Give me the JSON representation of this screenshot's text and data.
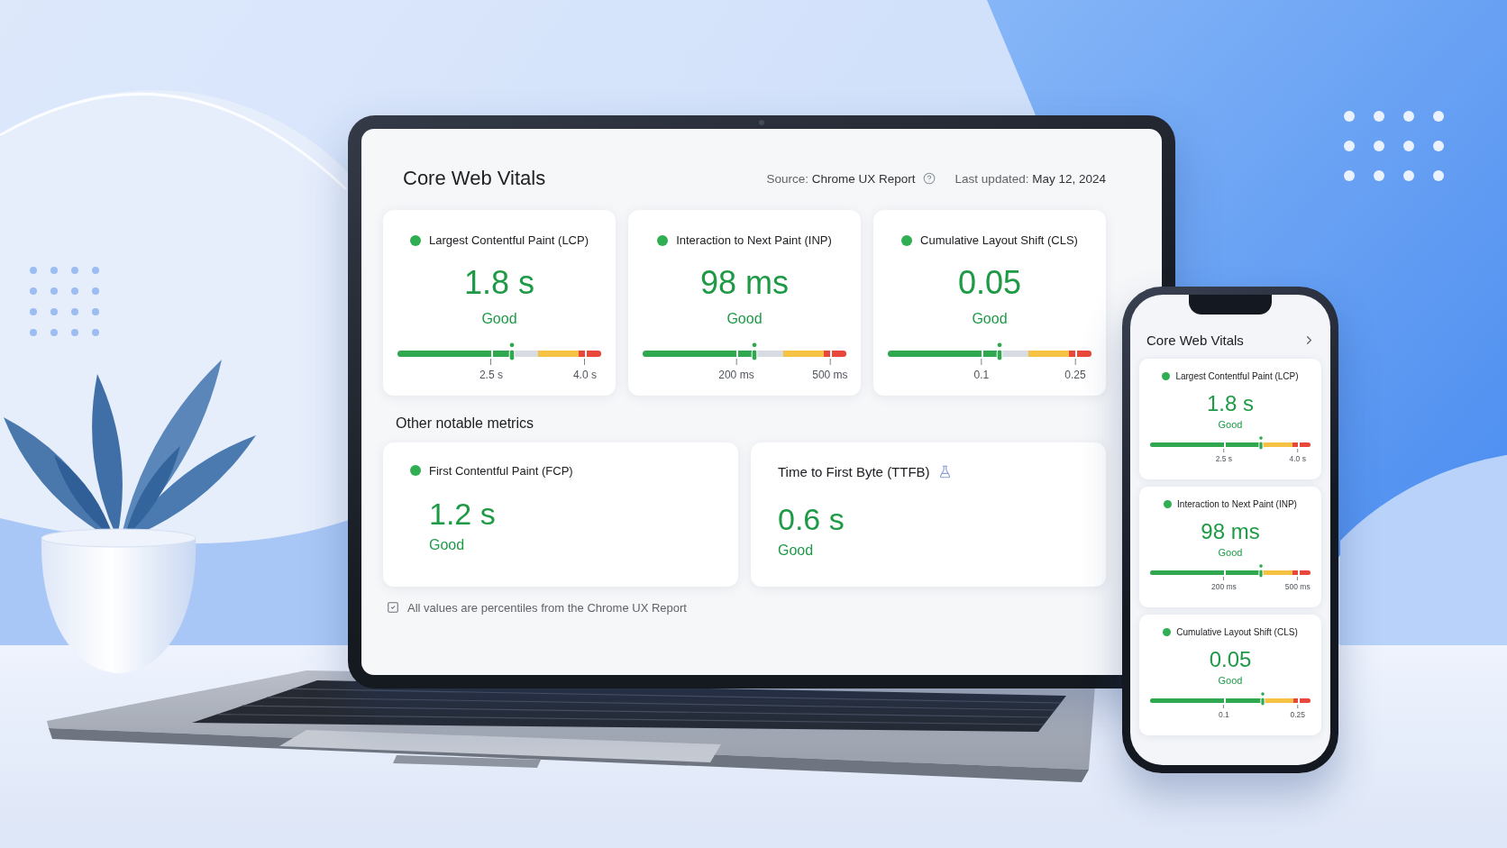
{
  "laptop": {
    "title": "Core Web Vitals",
    "source": {
      "label": "Source:",
      "value": "Chrome UX Report"
    },
    "last_updated": {
      "label": "Last updated:",
      "value": "May 12, 2024"
    },
    "metrics": [
      {
        "name": "Largest Contentful Paint (LCP)",
        "value": "1.8 s",
        "rating": "Good",
        "gauge": {
          "level": 0.56,
          "ticks": [
            "2.5 s",
            "4.0 s"
          ]
        }
      },
      {
        "name": "Interaction to Next Paint (INP)",
        "value": "98 ms",
        "rating": "Good",
        "gauge": {
          "level": 0.55,
          "ticks": [
            "200 ms",
            "500 ms"
          ]
        }
      },
      {
        "name": "Cumulative Layout Shift (CLS)",
        "value": "0.05",
        "rating": "Good",
        "gauge": {
          "level": 0.55,
          "ticks": [
            "0.1",
            "0.25"
          ]
        }
      }
    ],
    "other_heading": "Other notable metrics",
    "other_metrics": [
      {
        "kind": "dot",
        "name": "First Contentful Paint (FCP)",
        "value": "1.2 s",
        "rating": "Good"
      },
      {
        "kind": "flask",
        "name": "Time to First Byte (TTFB)",
        "value": "0.6 s",
        "rating": "Good"
      }
    ],
    "footnote": "All values are percentiles from the Chrome UX Report"
  },
  "phone": {
    "title": "Core Web Vitals",
    "metrics": [
      {
        "name": "Largest Contentful Paint (LCP)",
        "value": "1.8 s",
        "rating": "Good",
        "gauge": {
          "level": 0.69,
          "ticks": [
            "2.5 s",
            "4.0 s"
          ]
        }
      },
      {
        "name": "Interaction to Next Paint (INP)",
        "value": "98 ms",
        "rating": "Good",
        "gauge": {
          "level": 0.69,
          "ticks": [
            "200 ms",
            "500 ms"
          ]
        }
      },
      {
        "name": "Cumulative Layout Shift (CLS)",
        "value": "0.05",
        "rating": "Good",
        "gauge": {
          "level": 0.7,
          "ticks": [
            "0.1",
            "0.25"
          ]
        }
      }
    ]
  }
}
